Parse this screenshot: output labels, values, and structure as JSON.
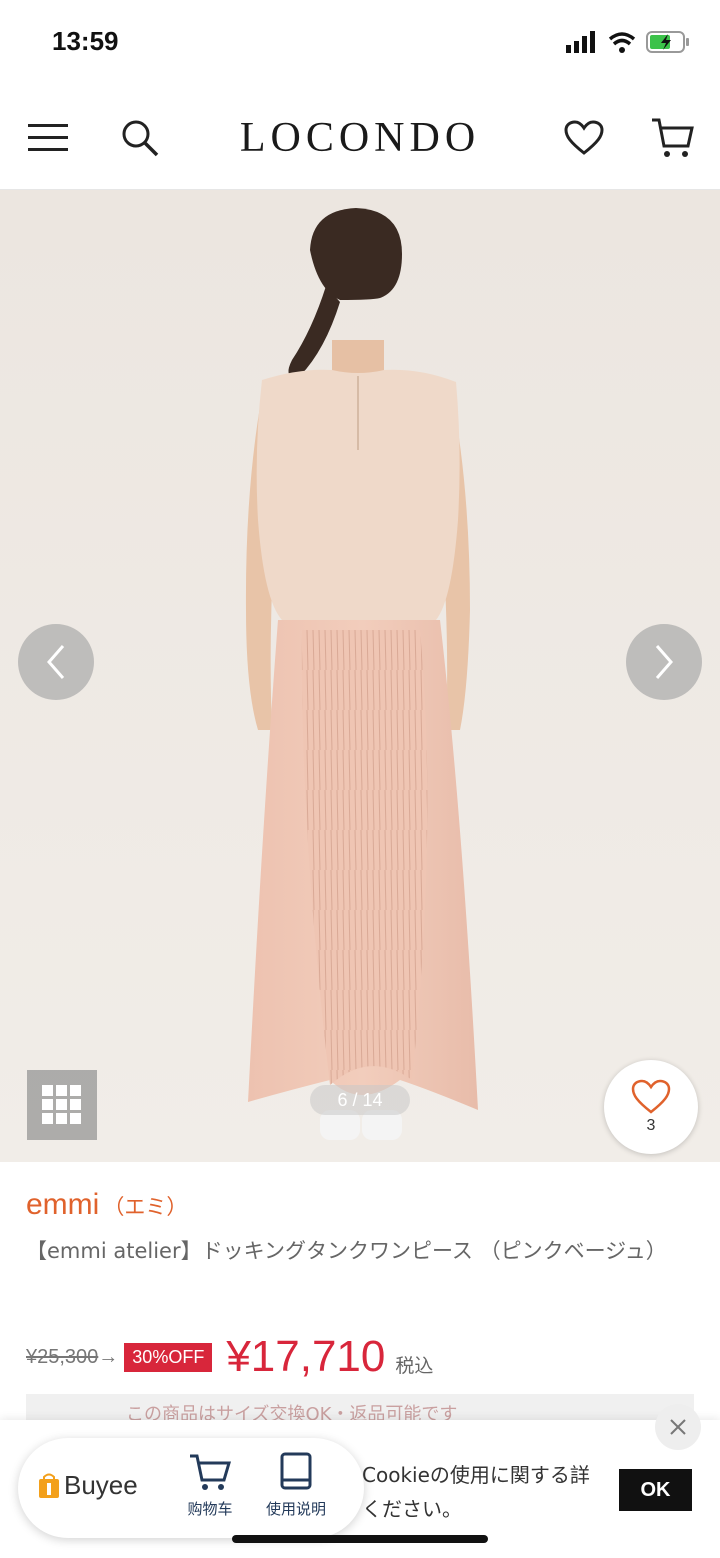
{
  "status_bar": {
    "time": "13:59"
  },
  "header": {
    "logo": "LOCONDO"
  },
  "gallery": {
    "counter": "6 / 14",
    "favorite_count": "3"
  },
  "product": {
    "brand": "emmi",
    "brand_kana": "（エミ）",
    "title": "【emmi atelier】ドッキングタンクワンピース （ピンクベージュ）",
    "original_price": "¥25,300",
    "arrow": "→",
    "discount_badge": "30%OFF",
    "sale_price": "¥17,710",
    "tax_label": "税込"
  },
  "notice": {
    "text": "この商品はサイズ交換OK・返品可能です"
  },
  "cookie": {
    "text": "Cookieの使用に関する詳ください。",
    "ok_label": "OK"
  },
  "buyee": {
    "logo": "Buyee",
    "cart_label": "购物车",
    "guide_label": "使用说明"
  },
  "colors": {
    "brand": "#e0622c",
    "sale": "#d8263b"
  }
}
